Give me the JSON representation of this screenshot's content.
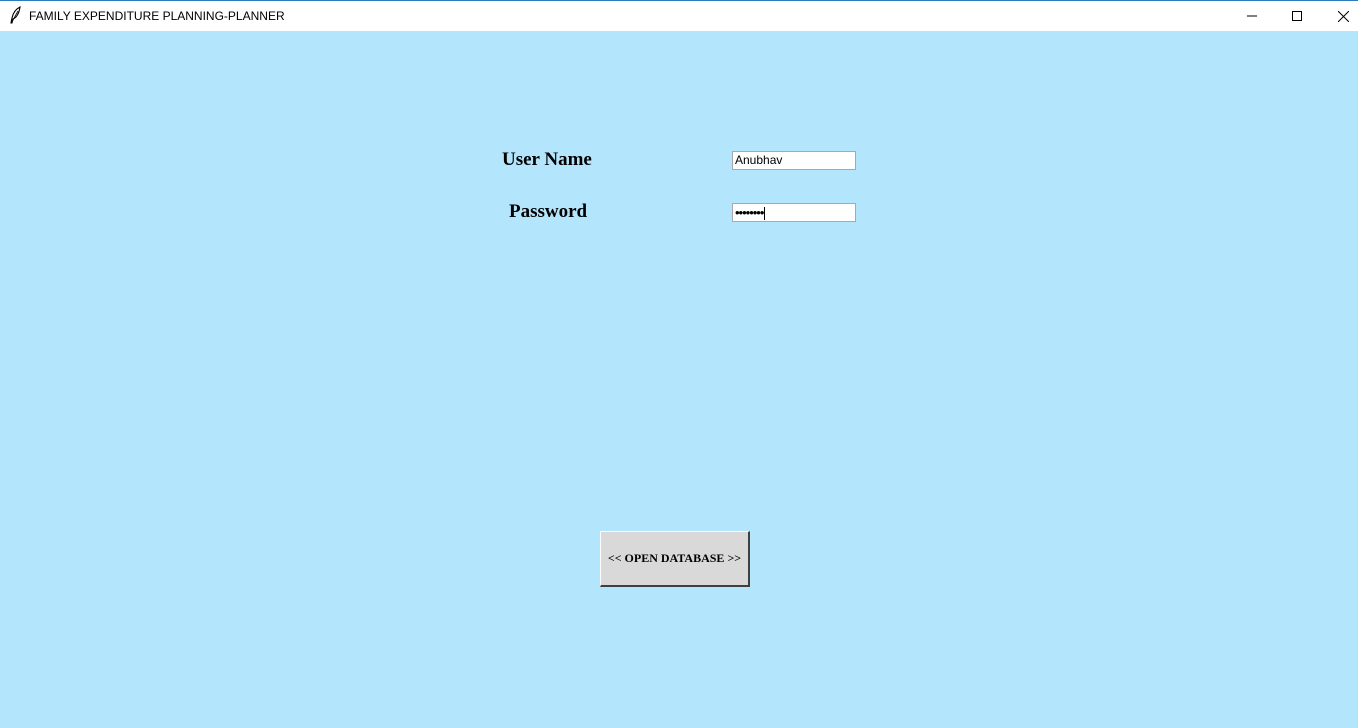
{
  "window": {
    "title": "FAMILY EXPENDITURE PLANNING-PLANNER",
    "app_icon": "feather-icon",
    "controls": [
      "minimize-icon",
      "maximize-icon",
      "close-icon"
    ]
  },
  "form": {
    "username_label": "User Name",
    "username_value": "Anubhav",
    "password_label": "Password",
    "password_masked": "••••••••"
  },
  "actions": {
    "open_database_label": "<< OPEN DATABASE >>"
  },
  "colors": {
    "background": "#b3e5fc",
    "button_face": "#d9d9d9",
    "field_background": "#ffffff"
  }
}
